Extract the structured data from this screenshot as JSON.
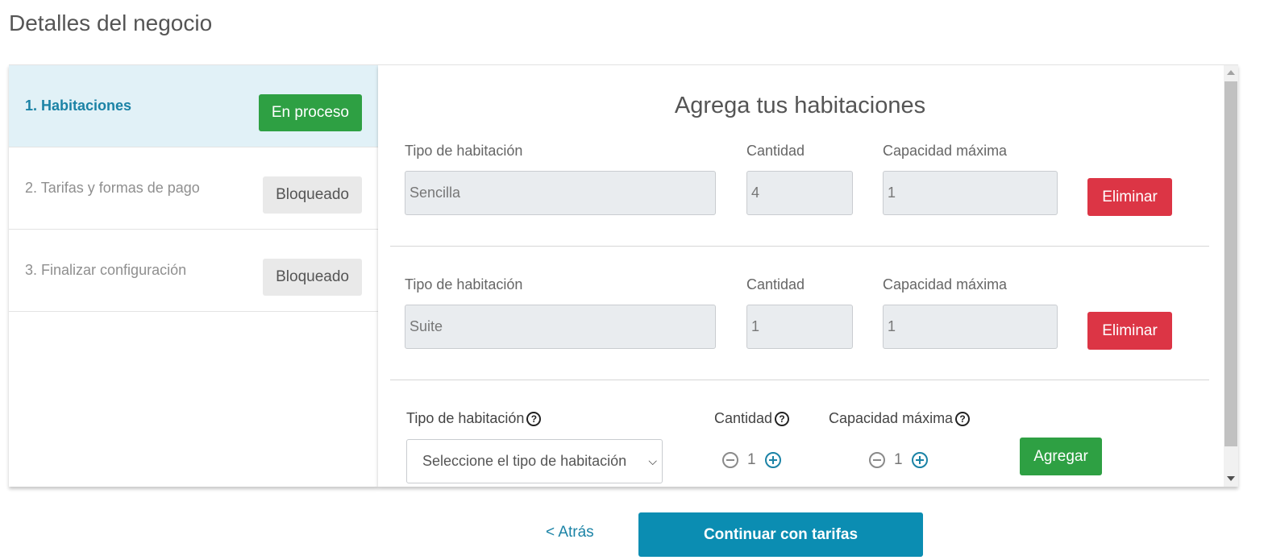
{
  "page": {
    "title": "Detalles del negocio"
  },
  "steps": [
    {
      "label": "1. Habitaciones",
      "status": "En proceso"
    },
    {
      "label": "2. Tarifas y formas de pago",
      "status": "Bloqueado"
    },
    {
      "label": "3. Finalizar configuración",
      "status": "Bloqueado"
    }
  ],
  "main": {
    "title": "Agrega tus habitaciones",
    "labels": {
      "room_type": "Tipo de habitación",
      "quantity": "Cantidad",
      "max_capacity": "Capacidad máxima"
    },
    "rooms": [
      {
        "type": "Sencilla",
        "quantity": "4",
        "capacity": "1",
        "delete_label": "Eliminar"
      },
      {
        "type": "Suite",
        "quantity": "1",
        "capacity": "1",
        "delete_label": "Eliminar"
      }
    ],
    "new_room": {
      "select_placeholder": "Seleccione el tipo de habitación",
      "quantity": "1",
      "capacity": "1",
      "add_label": "Agregar"
    }
  },
  "footer": {
    "back_label": "< Atrás",
    "continue_label": "Continuar con tarifas"
  },
  "colors": {
    "accent": "#1b83a6",
    "success": "#2ea043",
    "danger": "#dc3545",
    "primary_button": "#0b8db2"
  }
}
